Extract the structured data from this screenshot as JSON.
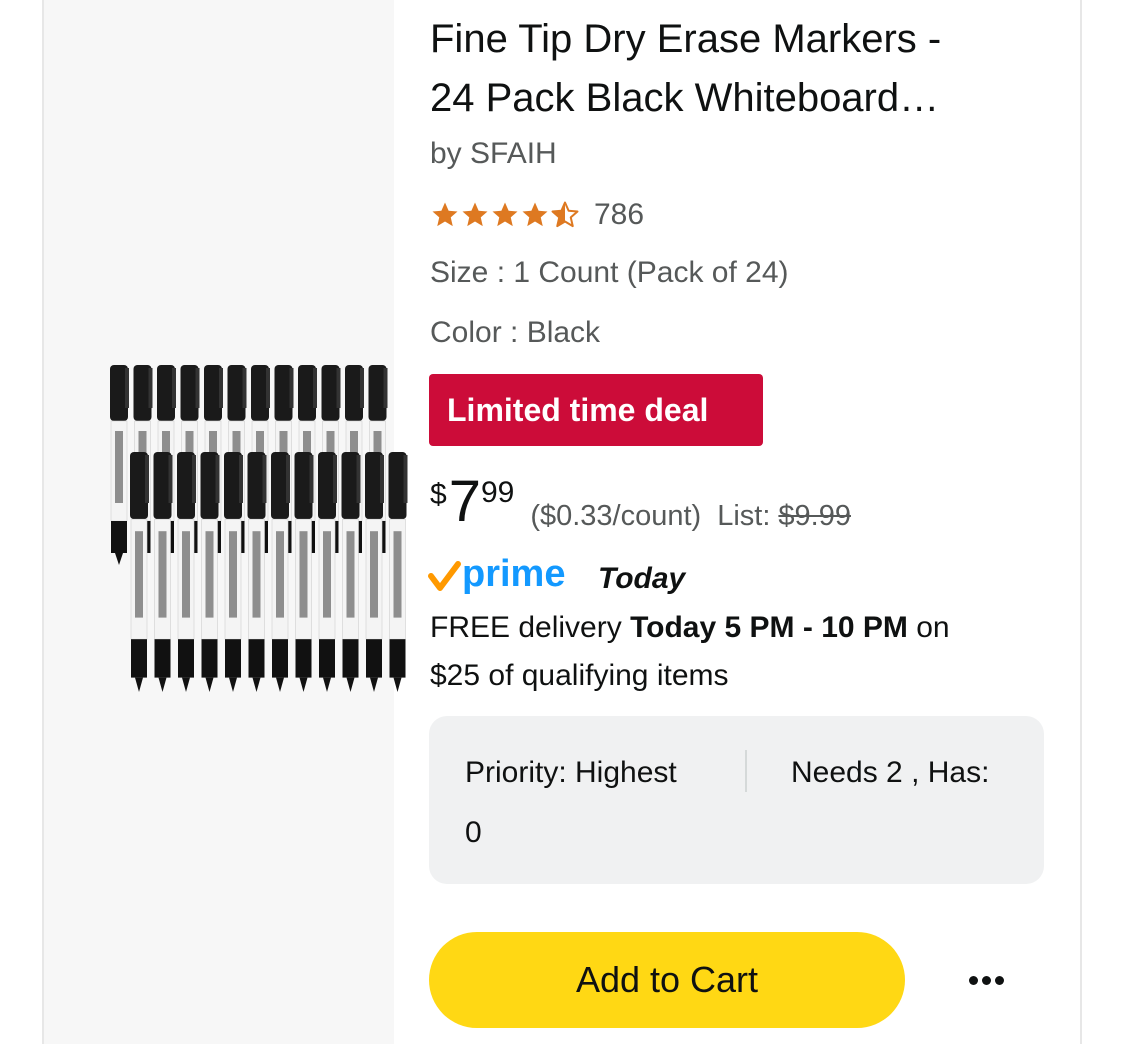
{
  "product": {
    "title_line1": "Fine Tip Dry Erase Markers -",
    "title_line2": "24 Pack Black Whiteboard…",
    "brand": "by SFAIH",
    "rating": 4.5,
    "review_count": "786",
    "size": "Size : 1 Count (Pack of 24)",
    "color": "Color : Black",
    "image_icon": "markers-product-image"
  },
  "deal": {
    "label": "Limited time deal",
    "color": "#cc0c39"
  },
  "price": {
    "symbol": "$",
    "whole": "7",
    "fraction": "99",
    "unit_price": "($0.33/count)",
    "list_label": "List:",
    "list_price": "$9.99"
  },
  "shipping": {
    "prime_label": "prime",
    "prime_day": "Today",
    "delivery_prefix": "FREE delivery ",
    "delivery_bold": "Today 5 PM - 10 PM",
    "delivery_suffix": " on",
    "delivery_line2": "$25 of qualifying items",
    "prime_color": "#1399ff",
    "check_color": "#ff9900"
  },
  "priority": {
    "label": "Priority: Highest",
    "needs": "Needs 2 , Has:",
    "has_value": "0"
  },
  "actions": {
    "add_to_cart": "Add to Cart",
    "more_icon": "more-options-icon",
    "button_color": "#ffd814"
  }
}
